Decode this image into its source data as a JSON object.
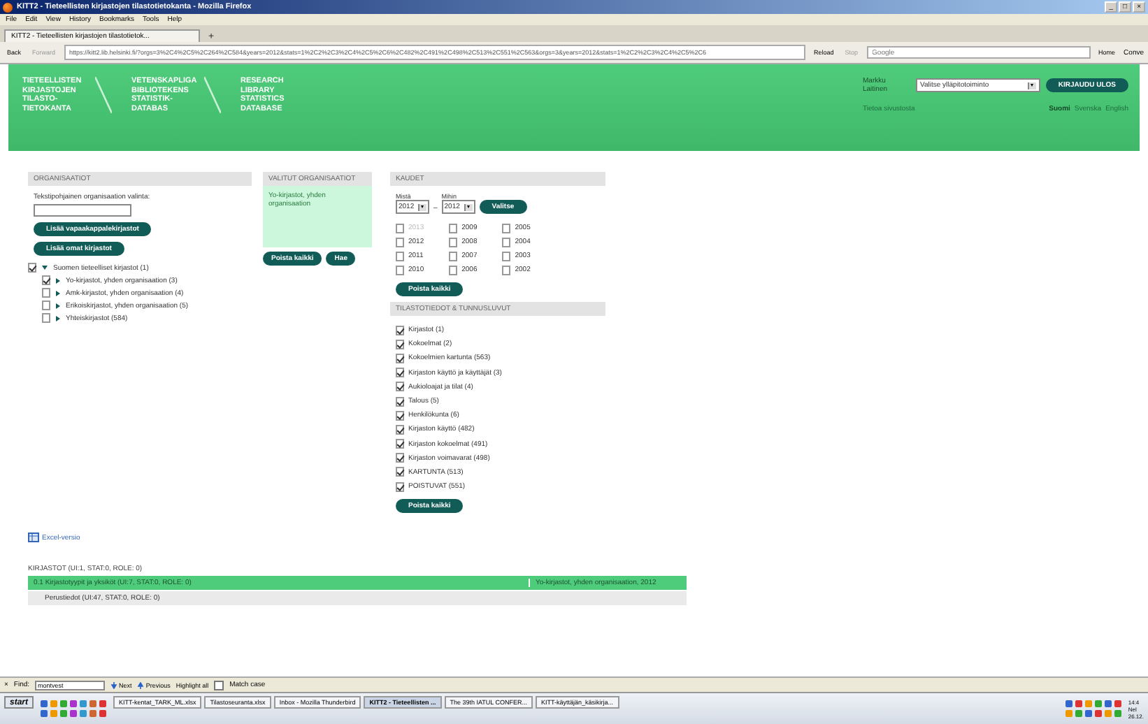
{
  "window": {
    "title": "KITT2 - Tieteellisten kirjastojen tilastotietokanta - Mozilla Firefox",
    "controls": [
      "_",
      "□",
      "×"
    ]
  },
  "menu": [
    "File",
    "Edit",
    "View",
    "History",
    "Bookmarks",
    "Tools",
    "Help"
  ],
  "tab": {
    "title": "KITT2 - Tieteellisten kirjastojen tilastotietok...",
    "new": "+"
  },
  "nav": {
    "back": "Back",
    "forward": "Forward",
    "url": "https://kitt2.lib.helsinki.fi/?orgs=3%2C4%2C5%2C264%2C584&years=2012&stats=1%2C2%2C3%2C4%2C5%2C6%2C482%2C491%2C498%2C513%2C551%2C563&orgs=3&years=2012&stats=1%2C2%2C3%2C4%2C5%2C6",
    "reload": "Reload",
    "stop": "Stop",
    "search_placeholder": "Google",
    "home": "Home",
    "extra": "Conve"
  },
  "header": {
    "logos": [
      [
        "TIETEELLISTEN",
        "KIRJASTOJEN",
        "TILASTO-",
        "TIETOKANTA"
      ],
      [
        "VETENSKAPLIGA",
        "BIBLIOTEKENS",
        "STATISTIK-",
        "DATABAS"
      ],
      [
        "RESEARCH",
        "LIBRARY",
        "STATISTICS",
        "DATABASE"
      ]
    ],
    "user": "Markku Laitinen",
    "select": "Valitse ylläpitotoiminto",
    "logout": "KIRJAUDU ULOS",
    "about": "Tietoa sivustosta",
    "languages": [
      {
        "label": "Suomi",
        "selected": true
      },
      {
        "label": "Svenska",
        "selected": false
      },
      {
        "label": "English",
        "selected": false
      }
    ]
  },
  "organisations": {
    "title": "ORGANISAATIOT",
    "field_label": "Tekstipohjainen organisaation valinta:",
    "buttons": [
      "Lisää vapaakappalekirjastot",
      "Lisää omat kirjastot"
    ],
    "tree": [
      {
        "label": "Suomen tieteelliset kirjastot (1)",
        "checked": true,
        "expanded": true,
        "children": [
          {
            "label": "Yo-kirjastot, yhden organisaation (3)",
            "checked": true,
            "expanded": false
          },
          {
            "label": "Amk-kirjastot, yhden organisaation (4)",
            "checked": false,
            "expanded": false
          },
          {
            "label": "Erikoiskirjastot, yhden organisaation (5)",
            "checked": false,
            "expanded": false
          },
          {
            "label": "Yhteiskirjastot (584)",
            "checked": false,
            "expanded": false
          }
        ]
      }
    ]
  },
  "selected_orgs": {
    "title": "VALITUT ORGANISAATIOT",
    "items": [
      "Yo-kirjastot, yhden organisaation"
    ],
    "buttons": [
      "Poista kaikki",
      "Hae"
    ]
  },
  "periods": {
    "title": "KAUDET",
    "from_label": "Mistä",
    "from": "2012",
    "dash": "–",
    "to_label": "Mihin",
    "to": "2012",
    "apply": "Valitse",
    "years": [
      {
        "label": "2013",
        "checked": false,
        "disabled": true
      },
      {
        "label": "2012",
        "checked": false,
        "disabled": false
      },
      {
        "label": "2011",
        "checked": false,
        "disabled": false
      },
      {
        "label": "2010",
        "checked": false,
        "disabled": false
      },
      {
        "label": "2009",
        "checked": false,
        "disabled": false
      },
      {
        "label": "2008",
        "checked": false,
        "disabled": false
      },
      {
        "label": "2007",
        "checked": false,
        "disabled": false
      },
      {
        "label": "2006",
        "checked": false,
        "disabled": false
      },
      {
        "label": "2005",
        "checked": false,
        "disabled": false
      },
      {
        "label": "2004",
        "checked": false,
        "disabled": false
      },
      {
        "label": "2003",
        "checked": false,
        "disabled": false
      },
      {
        "label": "2002",
        "checked": false,
        "disabled": false
      }
    ],
    "clear": "Poista kaikki"
  },
  "stats": {
    "title": "TILASTOTIEDOT & TUNNUSLUVUT",
    "items": [
      {
        "label": "Kirjastot (1)",
        "checked": true
      },
      {
        "label": "Kokoelmat (2)",
        "checked": true
      },
      {
        "label": "Kokoelmien kartunta (563)",
        "checked": true
      },
      {
        "label": "Kirjaston käyttö ja käyttäjät (3)",
        "checked": true
      },
      {
        "label": "Aukioloajat ja tilat (4)",
        "checked": true
      },
      {
        "label": "Talous (5)",
        "checked": true
      },
      {
        "label": "Henkilökunta (6)",
        "checked": true
      },
      {
        "label": "Kirjaston käyttö (482)",
        "checked": true
      },
      {
        "label": "Kirjaston kokoelmat (491)",
        "checked": true
      },
      {
        "label": "Kirjaston voimavarat (498)",
        "checked": true
      },
      {
        "label": "KARTUNTA (513)",
        "checked": true
      },
      {
        "label": "POISTUVAT (551)",
        "checked": true
      }
    ],
    "clear": "Poista kaikki"
  },
  "excel_link": "Excel-versio",
  "results": {
    "title": "KIRJASTOT (UI:1, STAT:0, ROLE: 0)",
    "rows": [
      {
        "cells": [
          "0.1 Kirjastotyypit ja yksiköt (UI:7, STAT:0, ROLE: 0)",
          "Yo-kirjastot, yhden organisaation, 2012"
        ],
        "selected": true
      },
      {
        "cells": [
          "Perustiedot (UI:47, STAT:0, ROLE: 0)",
          ""
        ],
        "selected": false
      }
    ]
  },
  "find_bar": {
    "close": "×",
    "label": "Find:",
    "value": "montvest",
    "next": "Next",
    "previous": "Previous",
    "highlight": "Highlight all",
    "match_case": "Match case",
    "match_checked": false
  },
  "taskbar": {
    "start": "start",
    "tasks": [
      {
        "label": "KITT-kentat_TARK_ML.xlsx",
        "selected": false
      },
      {
        "label": "Tilastoseuranta.xlsx",
        "selected": false
      },
      {
        "label": "Inbox - Mozilla Thunderbird",
        "selected": false
      },
      {
        "label": "KITT2 - Tieteellisten ...",
        "selected": true
      },
      {
        "label": "The 39th IATUL CONFER...",
        "selected": false
      },
      {
        "label": "KITT-käyttäjän_käsikirja...",
        "selected": false
      }
    ],
    "clock": [
      "14:4",
      "Nel",
      "26.12."
    ]
  }
}
